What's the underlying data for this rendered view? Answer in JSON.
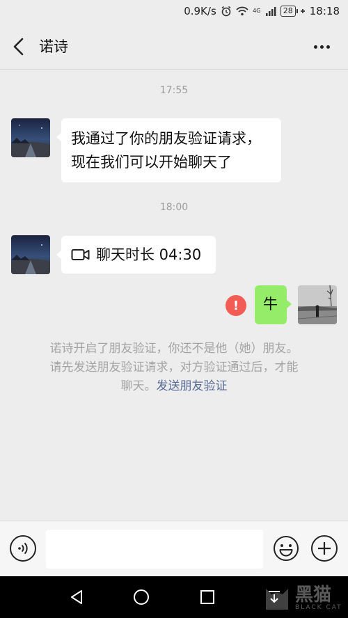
{
  "status_bar": {
    "speed": "0.9K/s",
    "network": "4G",
    "battery": "28",
    "time": "18:18"
  },
  "header": {
    "title": "诺诗",
    "back_icon": "chevron-left-icon",
    "more_icon": "more-dots-icon"
  },
  "messages": [
    {
      "type": "time",
      "text": "17:55"
    },
    {
      "type": "incoming",
      "line1": "我通过了你的朋友验证请求，",
      "line2": "现在我们可以开始聊天了"
    },
    {
      "type": "time",
      "text": "18:00"
    },
    {
      "type": "incoming-call",
      "icon": "video-camera-icon",
      "text": "聊天时长 04:30"
    },
    {
      "type": "outgoing",
      "text": "牛",
      "status": "failed",
      "status_icon": "exclamation-icon",
      "status_text": "!"
    }
  ],
  "system_notice": {
    "line1": "诺诗开启了朋友验证，你还不是他（她）朋友。",
    "line2": "请先发送朋友验证请求，对方验证通过后，才能",
    "line3_prefix": "聊天。",
    "link": "发送朋友验证"
  },
  "input_bar": {
    "voice_icon": "voice-icon",
    "emoji_icon": "emoji-icon",
    "plus_icon": "plus-icon",
    "placeholder": ""
  },
  "watermark": {
    "main": "黑猫",
    "sub": "BLACK CAT"
  },
  "colors": {
    "background": "#ededed",
    "outgoing_bubble": "#95ec69",
    "link": "#576b95",
    "error": "#f25c54"
  }
}
